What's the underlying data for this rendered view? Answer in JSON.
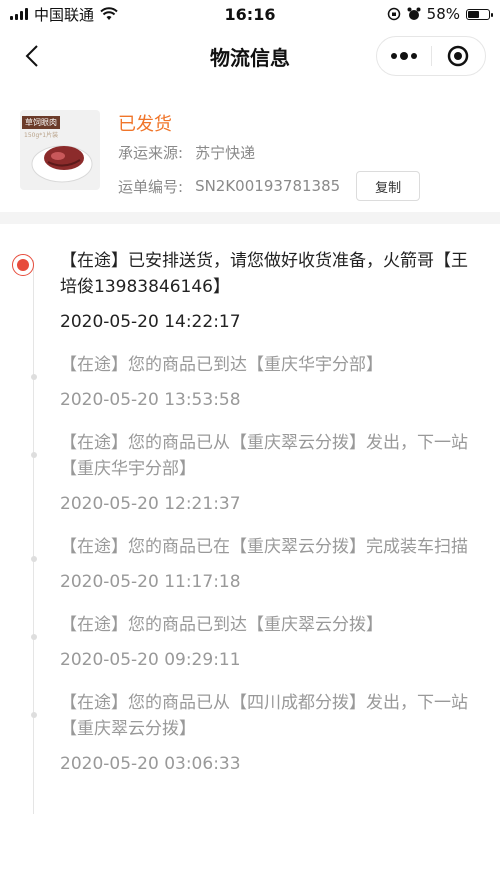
{
  "status_bar": {
    "carrier": "中国联通",
    "time": "16:16",
    "battery": "58%",
    "battery_level": 0.58
  },
  "nav": {
    "title": "物流信息"
  },
  "product": {
    "thumb_tag": "草饲眼肉",
    "thumb_sub": "150g*1片装",
    "status": "已发货",
    "carrier_label": "承运来源:",
    "carrier_value": "苏宁快递",
    "tracking_label": "运单编号:",
    "tracking_value": "SN2K00193781385",
    "copy_label": "复制"
  },
  "colors": {
    "accent": "#f0752a",
    "active_dot": "#e74c3c"
  },
  "timeline": [
    {
      "text": "【在途】已安排送货，请您做好收货准备，火箭哥【王培俊13983846146】",
      "time": "2020-05-20 14:22:17"
    },
    {
      "text": "【在途】您的商品已到达【重庆华宇分部】",
      "time": "2020-05-20 13:53:58"
    },
    {
      "text": "【在途】您的商品已从【重庆翠云分拨】发出，下一站【重庆华宇分部】",
      "time": "2020-05-20 12:21:37"
    },
    {
      "text": "【在途】您的商品已在【重庆翠云分拨】完成装车扫描",
      "time": "2020-05-20 11:17:18"
    },
    {
      "text": "【在途】您的商品已到达【重庆翠云分拨】",
      "time": "2020-05-20 09:29:11"
    },
    {
      "text": "【在途】您的商品已从【四川成都分拨】发出，下一站【重庆翠云分拨】",
      "time": "2020-05-20 03:06:33"
    }
  ]
}
